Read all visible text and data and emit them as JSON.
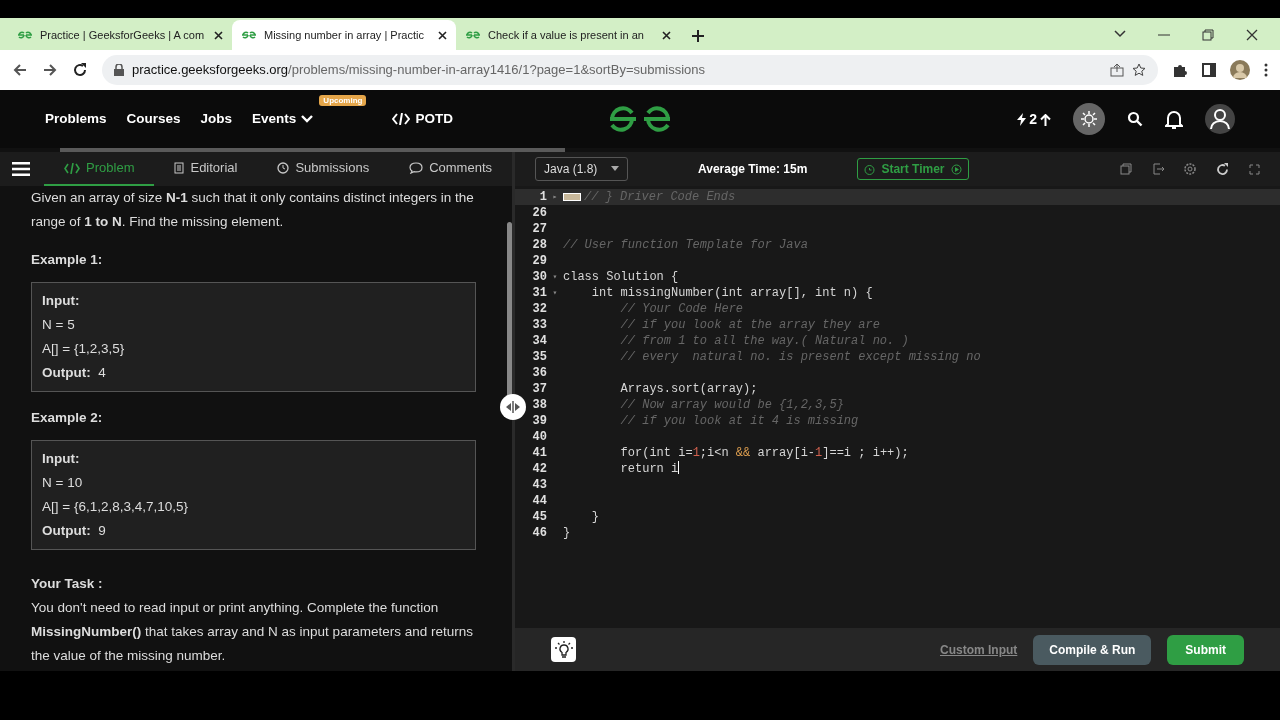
{
  "browser": {
    "tabs": [
      {
        "title": "Practice | GeeksforGeeks | A com",
        "selected": false
      },
      {
        "title": "Missing number in array | Practic",
        "selected": true
      },
      {
        "title": "Check if a value is present in an",
        "selected": false
      }
    ],
    "url": {
      "host": "practice.geeksforgeeks.org",
      "path": "/problems/missing-number-in-array1416/1?page=1&sortBy=submissions"
    }
  },
  "header": {
    "nav": [
      {
        "label": "Problems",
        "kind": "link"
      },
      {
        "label": "Courses",
        "kind": "link"
      },
      {
        "label": "Jobs",
        "kind": "link"
      },
      {
        "label": "Events",
        "kind": "dropdown",
        "badge": "Upcoming"
      },
      {
        "label": "POTD",
        "kind": "code"
      }
    ],
    "streak": "2"
  },
  "panel_tabs": [
    {
      "label": "Problem",
      "selected": true
    },
    {
      "label": "Editorial",
      "selected": false
    },
    {
      "label": "Submissions",
      "selected": false
    },
    {
      "label": "Comments",
      "selected": false
    }
  ],
  "problem": {
    "statement": "Given an array of size **N-1** such that it only contains distinct integers in the range of **1 to N**. Find the missing element.",
    "examples": [
      {
        "title": "Example 1:",
        "input_label": "Input:",
        "input": [
          "N = 5",
          "A[] = {1,2,3,5}"
        ],
        "output": "**Output:**  4"
      },
      {
        "title": "Example 2:",
        "input_label": "Input:",
        "input": [
          "N = 10",
          "A[] = {6,1,2,8,3,4,7,10,5}"
        ],
        "output": "**Output:**  9"
      }
    ],
    "task_title": "Your Task :",
    "task": "You don't need to read input or print anything. Complete the function **MissingNumber()** that takes array and N as input  parameters and returns the value of the missing number."
  },
  "editor": {
    "language": "Java (1.8)",
    "average_time": "Average Time: 15m",
    "timer_button": "Start Timer",
    "lines": [
      {
        "number": "1",
        "fold_marker": "▸",
        "highlight": true,
        "tokens": [
          {
            "text": "// } Driver Code Ends",
            "kind": "comment"
          }
        ]
      },
      {
        "number": "26"
      },
      {
        "number": "27"
      },
      {
        "number": "28",
        "tokens": [
          {
            "text": "// User function Template for Java",
            "kind": "comment"
          }
        ]
      },
      {
        "number": "29"
      },
      {
        "number": "30",
        "fold_marker": "▾",
        "tokens": [
          {
            "text": "class Solution {",
            "kind": "plain"
          }
        ]
      },
      {
        "number": "31",
        "fold_marker": "▾",
        "tokens": [
          {
            "text": "    int missingNumber(int array[], int n) {",
            "kind": "plain"
          }
        ]
      },
      {
        "number": "32",
        "tokens": [
          {
            "text": "        // Your Code Here",
            "kind": "comment"
          }
        ]
      },
      {
        "number": "33",
        "tokens": [
          {
            "text": "        // if you look at the array they are",
            "kind": "comment"
          }
        ]
      },
      {
        "number": "34",
        "tokens": [
          {
            "text": "        // from 1 to all the way.( Natural no. )",
            "kind": "comment"
          }
        ]
      },
      {
        "number": "35",
        "tokens": [
          {
            "text": "        // every  natural no. is present except missing no",
            "kind": "comment"
          }
        ]
      },
      {
        "number": "36"
      },
      {
        "number": "37",
        "tokens": [
          {
            "text": "        Arrays.sort(array);",
            "kind": "plain"
          }
        ]
      },
      {
        "number": "38",
        "tokens": [
          {
            "text": "        // Now array would be {1,2,3,5}",
            "kind": "comment"
          }
        ]
      },
      {
        "number": "39",
        "tokens": [
          {
            "text": "        // if you look at it 4 is missing",
            "kind": "comment"
          }
        ]
      },
      {
        "number": "40"
      },
      {
        "number": "41",
        "tokens": [
          {
            "text": "        for(int i=",
            "kind": "plain"
          },
          {
            "text": "1",
            "kind": "number"
          },
          {
            "text": ";i<n ",
            "kind": "plain"
          },
          {
            "text": "&&",
            "kind": "operator"
          },
          {
            "text": " array[i-",
            "kind": "plain"
          },
          {
            "text": "1",
            "kind": "number"
          },
          {
            "text": "]==i ; i++);",
            "kind": "plain"
          }
        ]
      },
      {
        "number": "42",
        "cursor": true,
        "tokens": [
          {
            "text": "        return i",
            "kind": "plain"
          }
        ]
      },
      {
        "number": "43"
      },
      {
        "number": "44"
      },
      {
        "number": "45",
        "tokens": [
          {
            "text": "    }",
            "kind": "plain"
          }
        ]
      },
      {
        "number": "46",
        "tokens": [
          {
            "text": "}",
            "kind": "plain"
          }
        ]
      }
    ],
    "custom_input": "Custom Input",
    "run_button": "Compile & Run",
    "submit_button": "Submit"
  }
}
